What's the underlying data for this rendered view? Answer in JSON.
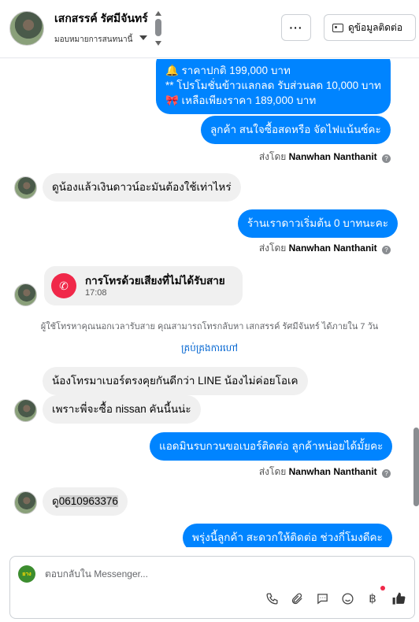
{
  "header": {
    "name": "เสกสรรค์ รัศมีจันทร์",
    "subtitle": "มอบหมายการสนทนานี้",
    "more_label": "···",
    "contact_button_label": "ดูข้อมูลติดต่อ"
  },
  "messages": {
    "m1_line2": "🔔 ราคาปกติ 199,000 บาท",
    "m1_line3": "** โปรโมชั่นข้าวแลกลด รับส่วนลด 10,000 บาท",
    "m1_line4": "🎀 เหลือเพียงราคา 189,000 บาท",
    "m2": "ลูกค้า สนใจซื้อสดหรือ จัดไฟแน้นซ์คะ",
    "sent_by_prefix": "ส่งโดย",
    "sent_by_name": "Nanwhan Nanthanit",
    "m3": "ดูน้องแล้วเงินดาวน์อะมันต้องใช้เท่าไหร่",
    "m4": "ร้านเราดาวเริ่มต้น 0 บาทนะคะ",
    "call_title": "การโทรด้วยเสียงที่ไม่ได้รับสาย",
    "call_time": "17:08",
    "notice": "ผู้ใช้โทรหาคุณนอกเวลารับสาย คุณสามารถโทรกลับหา เสกสรรค์ รัศมีจันทร์ ได้ภายใน 7 วัน",
    "link": "គ្រប់គ្រងការហៅ",
    "m5": "น้องโทรมาเบอร์ตรงคุยกันดีกว่า LINE น้องไม่ค่อยโอเค",
    "m6": "เพราะพี่จะซื้อ nissan คันนี้นน่ะ",
    "m7": "แอดมินรบกวนขอเบอร์ติดต่อ ลูกค้าหน่อยได้มั้ยคะ",
    "m8_prefix": "ดู",
    "m8_phone": "0610963376",
    "m9": "พรุ่งนี้ลูกค้า สะดวกให้ติดต่อ ช่วงกี่โมงดีคะ"
  },
  "composer": {
    "placeholder": "ตอบกลับใน Messenger...",
    "page_logo_text": "ยาง",
    "tools": [
      "phone-icon",
      "paperclip-icon",
      "quick-reply-icon",
      "emoji-icon",
      "baht-icon",
      "like-icon"
    ]
  },
  "colors": {
    "outgoing": "#0084ff",
    "incoming": "#f0f0f0",
    "missed_call": "#f02849",
    "link": "#0064d1"
  }
}
